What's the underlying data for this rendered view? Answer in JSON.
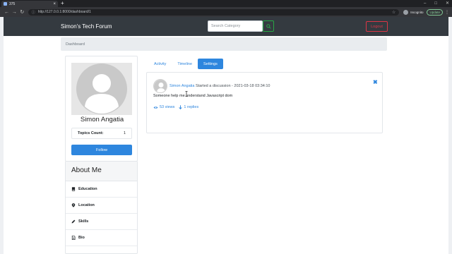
{
  "browser": {
    "tab_title": "375",
    "tab_close": "×",
    "new_tab": "+",
    "url": "http://127.0.0.1:8000/dashboard/1",
    "profile_label": "Incognito",
    "update_label": "Update",
    "win_controls": [
      "–",
      "□",
      "✕"
    ],
    "nav_icons": [
      "arrow-left-icon",
      "arrow-right-icon",
      "reload-icon"
    ]
  },
  "navbar": {
    "brand": "Simon's Tech Forum",
    "search_placeholder": "Search Category",
    "logout_label": "Logout"
  },
  "breadcrumb": {
    "label": "Dashboard"
  },
  "profile": {
    "name": "Simon Angatia",
    "topics_label": "Topics Count:",
    "topics_count": "1",
    "follow_label": "Follow"
  },
  "about": {
    "title": "About Me",
    "items": [
      {
        "label": "Education",
        "icon": "book-icon"
      },
      {
        "label": "Location",
        "icon": "map-marker-icon"
      },
      {
        "label": "Skills",
        "icon": "pencil-icon"
      },
      {
        "label": "Bio",
        "icon": "file-icon"
      }
    ]
  },
  "tabs": [
    {
      "label": "Activity",
      "active": false
    },
    {
      "label": "Timeline",
      "active": false
    },
    {
      "label": "Settings",
      "active": true
    }
  ],
  "post": {
    "author": "Simon Angatia",
    "action": " Started a discussion - 2021-03-18 03:34:10",
    "body": "Someone help me understand Javascript dom",
    "views": "53 views",
    "replies": "1 replies",
    "close": "✖"
  },
  "colors": {
    "accent": "#2e86de",
    "navbar": "#343a40",
    "danger": "#dc3545",
    "success": "#28a745"
  }
}
